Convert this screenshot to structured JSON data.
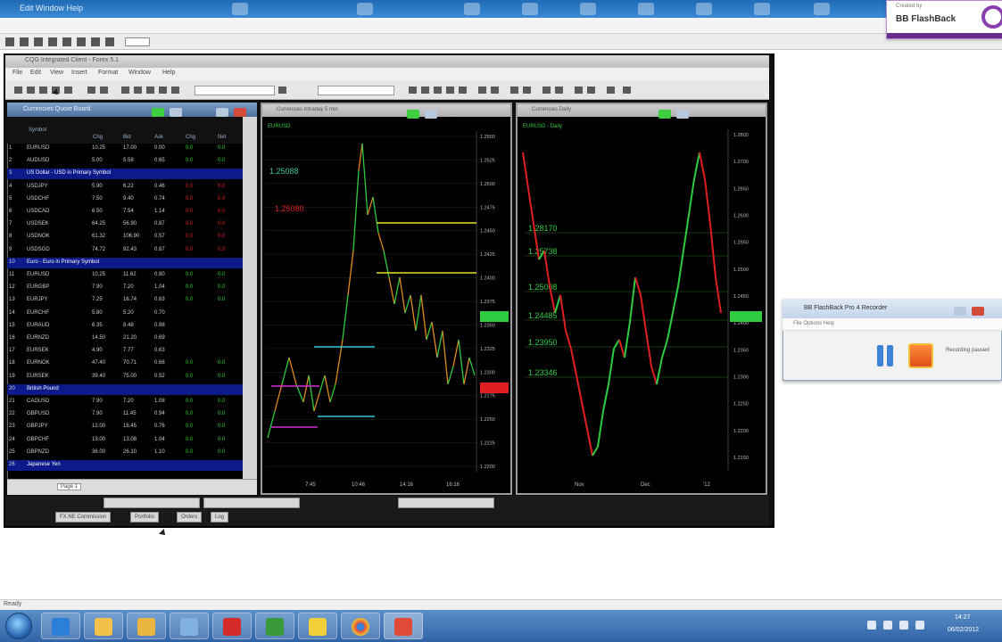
{
  "app_bar": {
    "title": "Edit  Window  Help"
  },
  "flashback": {
    "small_label": "Created by",
    "brand": "BB FlashBack"
  },
  "inner_window": {
    "title": "CQG Integrated Client - Forex 5.1",
    "menu": [
      "File",
      "Edit",
      "View",
      "Insert",
      "Format",
      "Window",
      "Help"
    ]
  },
  "quote_board": {
    "title": "Currencies Quote Board",
    "columns": {
      "name": "Symbol",
      "c1": "Chg",
      "c2": "Bid",
      "c3": "Ask",
      "c4": "Chg",
      "c5": "Net"
    },
    "rows": [
      {
        "idx": "1",
        "sym": "EURUSD",
        "c1": "10.25",
        "c2": "17.00",
        "c3": "0.00",
        "c4": "0.0",
        "c5": "0.0",
        "dir": "up"
      },
      {
        "idx": "2",
        "sym": "AUDUSD",
        "c1": "5.00",
        "c2": "5.58",
        "c3": "0.65",
        "c4": "0.0",
        "c5": "0.0",
        "dir": "up"
      },
      {
        "idx": "3",
        "sym": "US Dollar - USD in Primary Symbol",
        "header": true
      },
      {
        "idx": "4",
        "sym": "USDJPY",
        "c1": "5.90",
        "c2": "6.22",
        "c3": "0.46",
        "c4": "0.0",
        "c5": "0.0",
        "dir": "dn"
      },
      {
        "idx": "5",
        "sym": "USDCHF",
        "c1": "7.50",
        "c2": "9.40",
        "c3": "0.74",
        "c4": "0.0",
        "c5": "0.0",
        "dir": "dn"
      },
      {
        "idx": "6",
        "sym": "USDCAD",
        "c1": "6.50",
        "c2": "7.54",
        "c3": "1.14",
        "c4": "0.0",
        "c5": "0.0",
        "dir": "dn"
      },
      {
        "idx": "7",
        "sym": "USDSEK",
        "c1": "64.25",
        "c2": "56.90",
        "c3": "0.87",
        "c4": "0.0",
        "c5": "0.0",
        "dir": "dn"
      },
      {
        "idx": "8",
        "sym": "USDNOK",
        "c1": "61.32",
        "c2": "106.90",
        "c3": "0.57",
        "c4": "0.0",
        "c5": "0.0",
        "dir": "dn"
      },
      {
        "idx": "9",
        "sym": "USDSGD",
        "c1": "74.72",
        "c2": "92.43",
        "c3": "0.87",
        "c4": "0.0",
        "c5": "0.0",
        "dir": "dn"
      },
      {
        "idx": "10",
        "sym": "Euro - Euro in Primary Symbol",
        "header": true
      },
      {
        "idx": "11",
        "sym": "EURUSD",
        "c1": "10.25",
        "c2": "11.62",
        "c3": "0.80",
        "c4": "0.0",
        "c5": "0.0",
        "dir": "up"
      },
      {
        "idx": "12",
        "sym": "EURGBP",
        "c1": "7.90",
        "c2": "7.20",
        "c3": "1.04",
        "c4": "0.0",
        "c5": "0.0",
        "dir": "up"
      },
      {
        "idx": "13",
        "sym": "EURJPY",
        "c1": "7.25",
        "c2": "16.74",
        "c3": "0.63",
        "c4": "0.0",
        "c5": "0.0",
        "dir": "up"
      },
      {
        "idx": "14",
        "sym": "EURCHF",
        "c1": "5.80",
        "c2": "5.20",
        "c3": "0.70",
        "c4": "",
        "c5": "",
        "dir": "dn"
      },
      {
        "idx": "15",
        "sym": "EURAUD",
        "c1": "6.35",
        "c2": "8.48",
        "c3": "0.98",
        "c4": "",
        "c5": "",
        "dir": "dn"
      },
      {
        "idx": "16",
        "sym": "EURNZD",
        "c1": "14.50",
        "c2": "21.20",
        "c3": "0.69",
        "c4": "",
        "c5": "",
        "dir": "dn"
      },
      {
        "idx": "17",
        "sym": "EURSEK",
        "c1": "4.90",
        "c2": "7.77",
        "c3": "0.63",
        "c4": "",
        "c5": "",
        "dir": "dn"
      },
      {
        "idx": "18",
        "sym": "EURNOK",
        "c1": "47.40",
        "c2": "70.71",
        "c3": "0.66",
        "c4": "0.0",
        "c5": "0.0",
        "dir": "up"
      },
      {
        "idx": "19",
        "sym": "EURSEK",
        "c1": "39.40",
        "c2": "75.00",
        "c3": "0.52",
        "c4": "0.0",
        "c5": "0.0",
        "dir": "up"
      },
      {
        "idx": "20",
        "sym": "British Pound",
        "header": true
      },
      {
        "idx": "21",
        "sym": "CADUSD",
        "c1": "7.90",
        "c2": "7.20",
        "c3": "1.08",
        "c4": "0.0",
        "c5": "0.0",
        "dir": "up"
      },
      {
        "idx": "22",
        "sym": "GBPUSD",
        "c1": "7.90",
        "c2": "11.45",
        "c3": "0.94",
        "c4": "0.0",
        "c5": "0.0",
        "dir": "up"
      },
      {
        "idx": "23",
        "sym": "GBPJPY",
        "c1": "12.00",
        "c2": "16.45",
        "c3": "0.76",
        "c4": "0.0",
        "c5": "0.0",
        "dir": "up"
      },
      {
        "idx": "24",
        "sym": "GBPCHF",
        "c1": "13.00",
        "c2": "13.08",
        "c3": "1.04",
        "c4": "0.0",
        "c5": "0.0",
        "dir": "up"
      },
      {
        "idx": "25",
        "sym": "GBPNZD",
        "c1": "36.00",
        "c2": "26.10",
        "c3": "1.10",
        "c4": "0.0",
        "c5": "0.0",
        "dir": "up"
      },
      {
        "idx": "26",
        "sym": "Japanese Yen",
        "header": true
      }
    ],
    "footer_tab": "Page 1"
  },
  "chart_left": {
    "title": "Currencies Intraday 5 min",
    "legend": "EURUSD",
    "price_labels": [
      "1.25088",
      "1.25080"
    ],
    "y_ticks": [
      "1.2550",
      "1.2525",
      "1.2500",
      "1.2475",
      "1.2450",
      "1.2425",
      "1.2400",
      "1.2375",
      "1.2350",
      "1.2325",
      "1.2300",
      "1.2275",
      "1.2250",
      "1.2225",
      "1.2200"
    ],
    "x_ticks": [
      "7:45",
      "10:46",
      "14:16",
      "16:16"
    ],
    "colors": {
      "green": "#2ecc40",
      "orange": "#e08a1e",
      "yellow": "#e6dd2a",
      "cyan": "#39c6d6",
      "magenta": "#d22fd2",
      "red": "#e02020"
    }
  },
  "chart_right": {
    "title": "Currencies Daily",
    "legend": "EURUSD - Daily",
    "price_labels": [
      "1.28170",
      "1.25738",
      "1.25008",
      "1.24485",
      "1.23950",
      "1.23346"
    ],
    "y_ticks": [
      "1.2800",
      "1.2700",
      "1.2650",
      "1.2600",
      "1.2550",
      "1.2500",
      "1.2450",
      "1.2400",
      "1.2350",
      "1.2300",
      "1.2250",
      "1.2200",
      "1.2150"
    ],
    "x_ticks": [
      "Nov",
      "Dec",
      "'12"
    ]
  },
  "bottom_tabs": [
    "FX.NE Commission",
    "Portfolio",
    "Orders",
    "Log"
  ],
  "recorder": {
    "title": "BB FlashBack Pro 4 Recorder",
    "menu": "File   Options   Help",
    "status": "Recording paused"
  },
  "status_bar": {
    "text": "Ready"
  },
  "taskbar": {
    "time": "14:27",
    "date": "06/02/2012"
  }
}
